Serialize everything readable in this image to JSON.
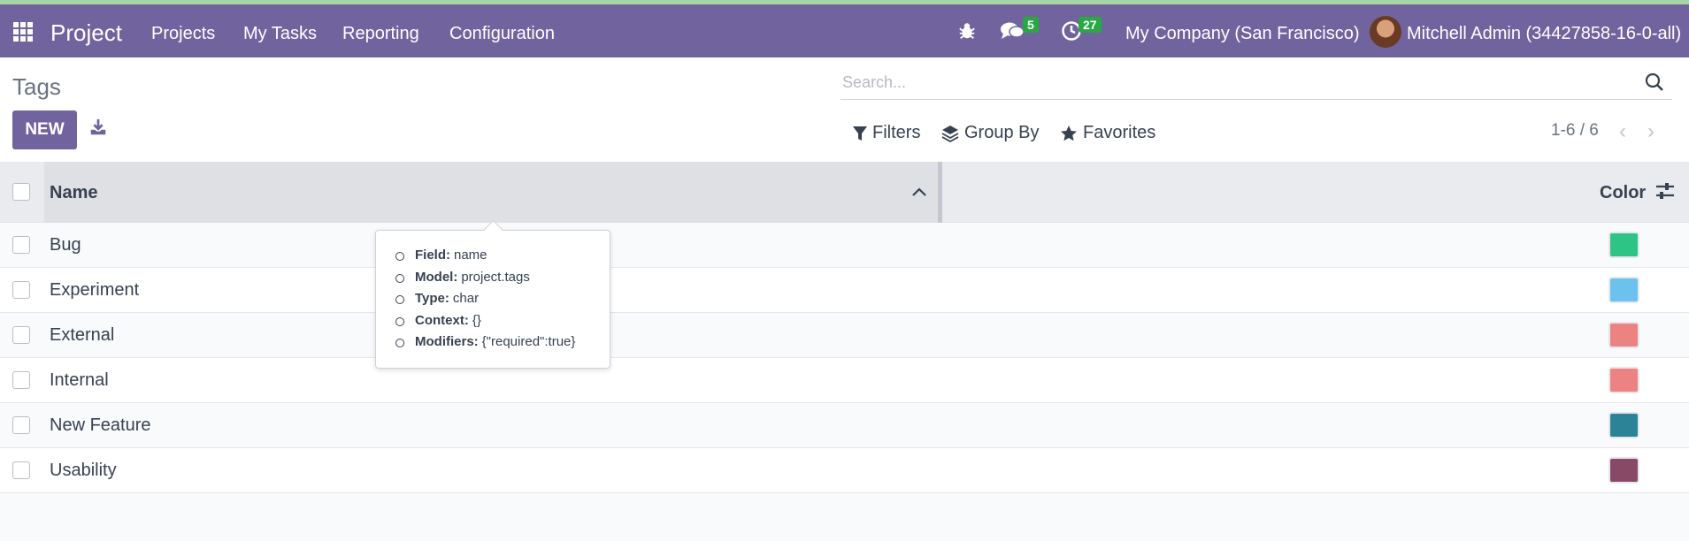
{
  "navbar": {
    "brand": "Project",
    "menu": [
      "Projects",
      "My Tasks",
      "Reporting",
      "Configuration"
    ],
    "messages_count": "5",
    "activities_count": "27",
    "company": "My Company (San Francisco)",
    "user": "Mitchell Admin (34427858-16-0-all)",
    "color": "#71639e"
  },
  "control": {
    "title": "Tags",
    "new_label": "NEW",
    "search_placeholder": "Search...",
    "filters_label": "Filters",
    "group_by_label": "Group By",
    "favorites_label": "Favorites",
    "pager": "1-6 / 6"
  },
  "table": {
    "columns": {
      "name": "Name",
      "color": "Color"
    },
    "rows": [
      {
        "name": "Bug",
        "color": "#2ec486"
      },
      {
        "name": "Experiment",
        "color": "#6cc1ed"
      },
      {
        "name": "External",
        "color": "#ed8282"
      },
      {
        "name": "Internal",
        "color": "#ed8282"
      },
      {
        "name": "New Feature",
        "color": "#2c8397"
      },
      {
        "name": "Usability",
        "color": "#874965"
      }
    ]
  },
  "tooltip": {
    "items": [
      {
        "key": "Field:",
        "value": "name"
      },
      {
        "key": "Model:",
        "value": "project.tags"
      },
      {
        "key": "Type:",
        "value": "char"
      },
      {
        "key": "Context:",
        "value": "{}"
      },
      {
        "key": "Modifiers:",
        "value": "{\"required\":true}"
      }
    ]
  }
}
